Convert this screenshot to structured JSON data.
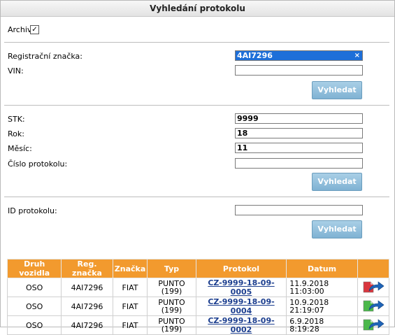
{
  "panel": {
    "title": "Vyhledání protokolu"
  },
  "archive": {
    "label": "Archiv",
    "checked": true,
    "check_glyph": "✓"
  },
  "section1": {
    "reg_label": "Registrační značka:",
    "reg_value": "4AI7296",
    "clear_glyph": "×",
    "vin_label": "VIN:",
    "vin_value": "",
    "button": "Vyhledat"
  },
  "section2": {
    "stk_label": "STK:",
    "stk_value": "9999",
    "rok_label": "Rok:",
    "rok_value": "18",
    "mesic_label": "Měsíc:",
    "mesic_value": "11",
    "cislo_label": "Číslo protokolu:",
    "cislo_value": "",
    "button": "Vyhledat"
  },
  "section3": {
    "id_label": "ID protokolu:",
    "id_value": "",
    "button": "Vyhledat"
  },
  "table": {
    "headers": [
      "Druh vozidla",
      "Reg. značka",
      "Značka",
      "Typ",
      "Protokol",
      "Datum",
      ""
    ],
    "rows": [
      {
        "druh": "OSO",
        "reg": "4AI7296",
        "znacka": "FIAT",
        "typ1": "PUNTO",
        "typ2": "(199)",
        "protokol": "CZ-9999-18-09-0005",
        "datum1": "11.9.2018",
        "datum2": "11:03:00",
        "doc_color": "#d9363e"
      },
      {
        "druh": "OSO",
        "reg": "4AI7296",
        "znacka": "FIAT",
        "typ1": "PUNTO",
        "typ2": "(199)",
        "protokol": "CZ-9999-18-09-0004",
        "datum1": "10.9.2018",
        "datum2": "21:19:07",
        "doc_color": "#4bb84b"
      },
      {
        "druh": "OSO",
        "reg": "4AI7296",
        "znacka": "FIAT",
        "typ1": "PUNTO",
        "typ2": "(199)",
        "protokol": "CZ-9999-18-09-0002",
        "datum1": "6.9.2018 8:19:28",
        "datum2": "",
        "doc_color": "#4bb84b"
      }
    ]
  },
  "colors": {
    "header_bg": "#f29a2e",
    "button_bg": "#8fbfdd",
    "selection": "#1e6fd9",
    "link": "#1d3f8f"
  }
}
